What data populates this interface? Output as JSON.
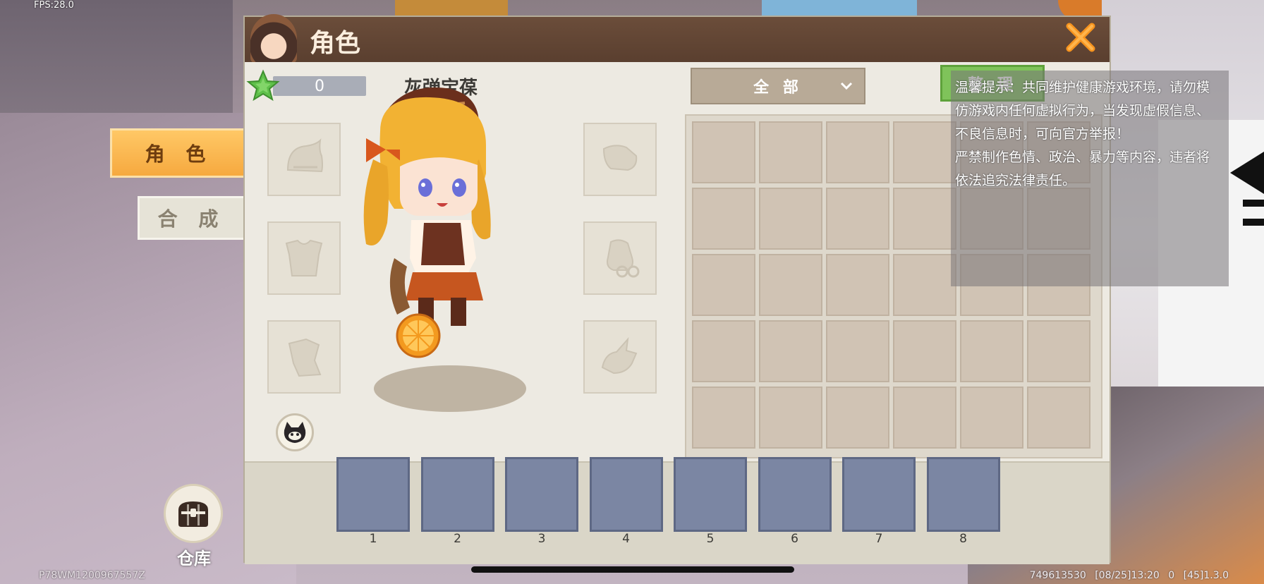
{
  "hud": {
    "fps": "FPS:28.0",
    "device_id": "P78WM1200967557Z",
    "footer_info": "749613530  [08/25]13:20 0  [45]1.3.0"
  },
  "side_tabs": [
    {
      "label": "角 色",
      "active": true
    },
    {
      "label": "合 成",
      "active": false
    }
  ],
  "warehouse": {
    "label": "仓库",
    "icon": "treasure-chest-icon"
  },
  "panel": {
    "title": "角色",
    "close_icon": "close-x-icon",
    "level_value": "0",
    "character_name": "灰弹宝葆",
    "filter": {
      "selected": "全 部"
    },
    "tidy_label": "整 理",
    "equip_slots_left": [
      "helmet-icon",
      "chestplate-icon",
      "cape-icon"
    ],
    "equip_slots_right": [
      "boots-icon",
      "accessory-icon",
      "mount-icon"
    ],
    "inventory_rows": 5,
    "inventory_cols": 6
  },
  "notice": {
    "lines": [
      "温馨提示：共同维护健康游戏环境，请勿模",
      "仿游戏内任何虚拟行为，当发现虚假信息、",
      "不良信息时，可向官方举报！",
      "严禁制作色情、政治、暴力等内容，违者将",
      "依法追究法律责任。"
    ]
  },
  "hotbar": {
    "numbers": [
      "1",
      "2",
      "3",
      "4",
      "5",
      "6",
      "7",
      "8"
    ]
  },
  "colors": {
    "accent_orange": "#f6a93f",
    "header_brown": "#5a3f2f",
    "tidy_green": "#7fc35a",
    "hotbar_slot": "#7b86a3"
  }
}
